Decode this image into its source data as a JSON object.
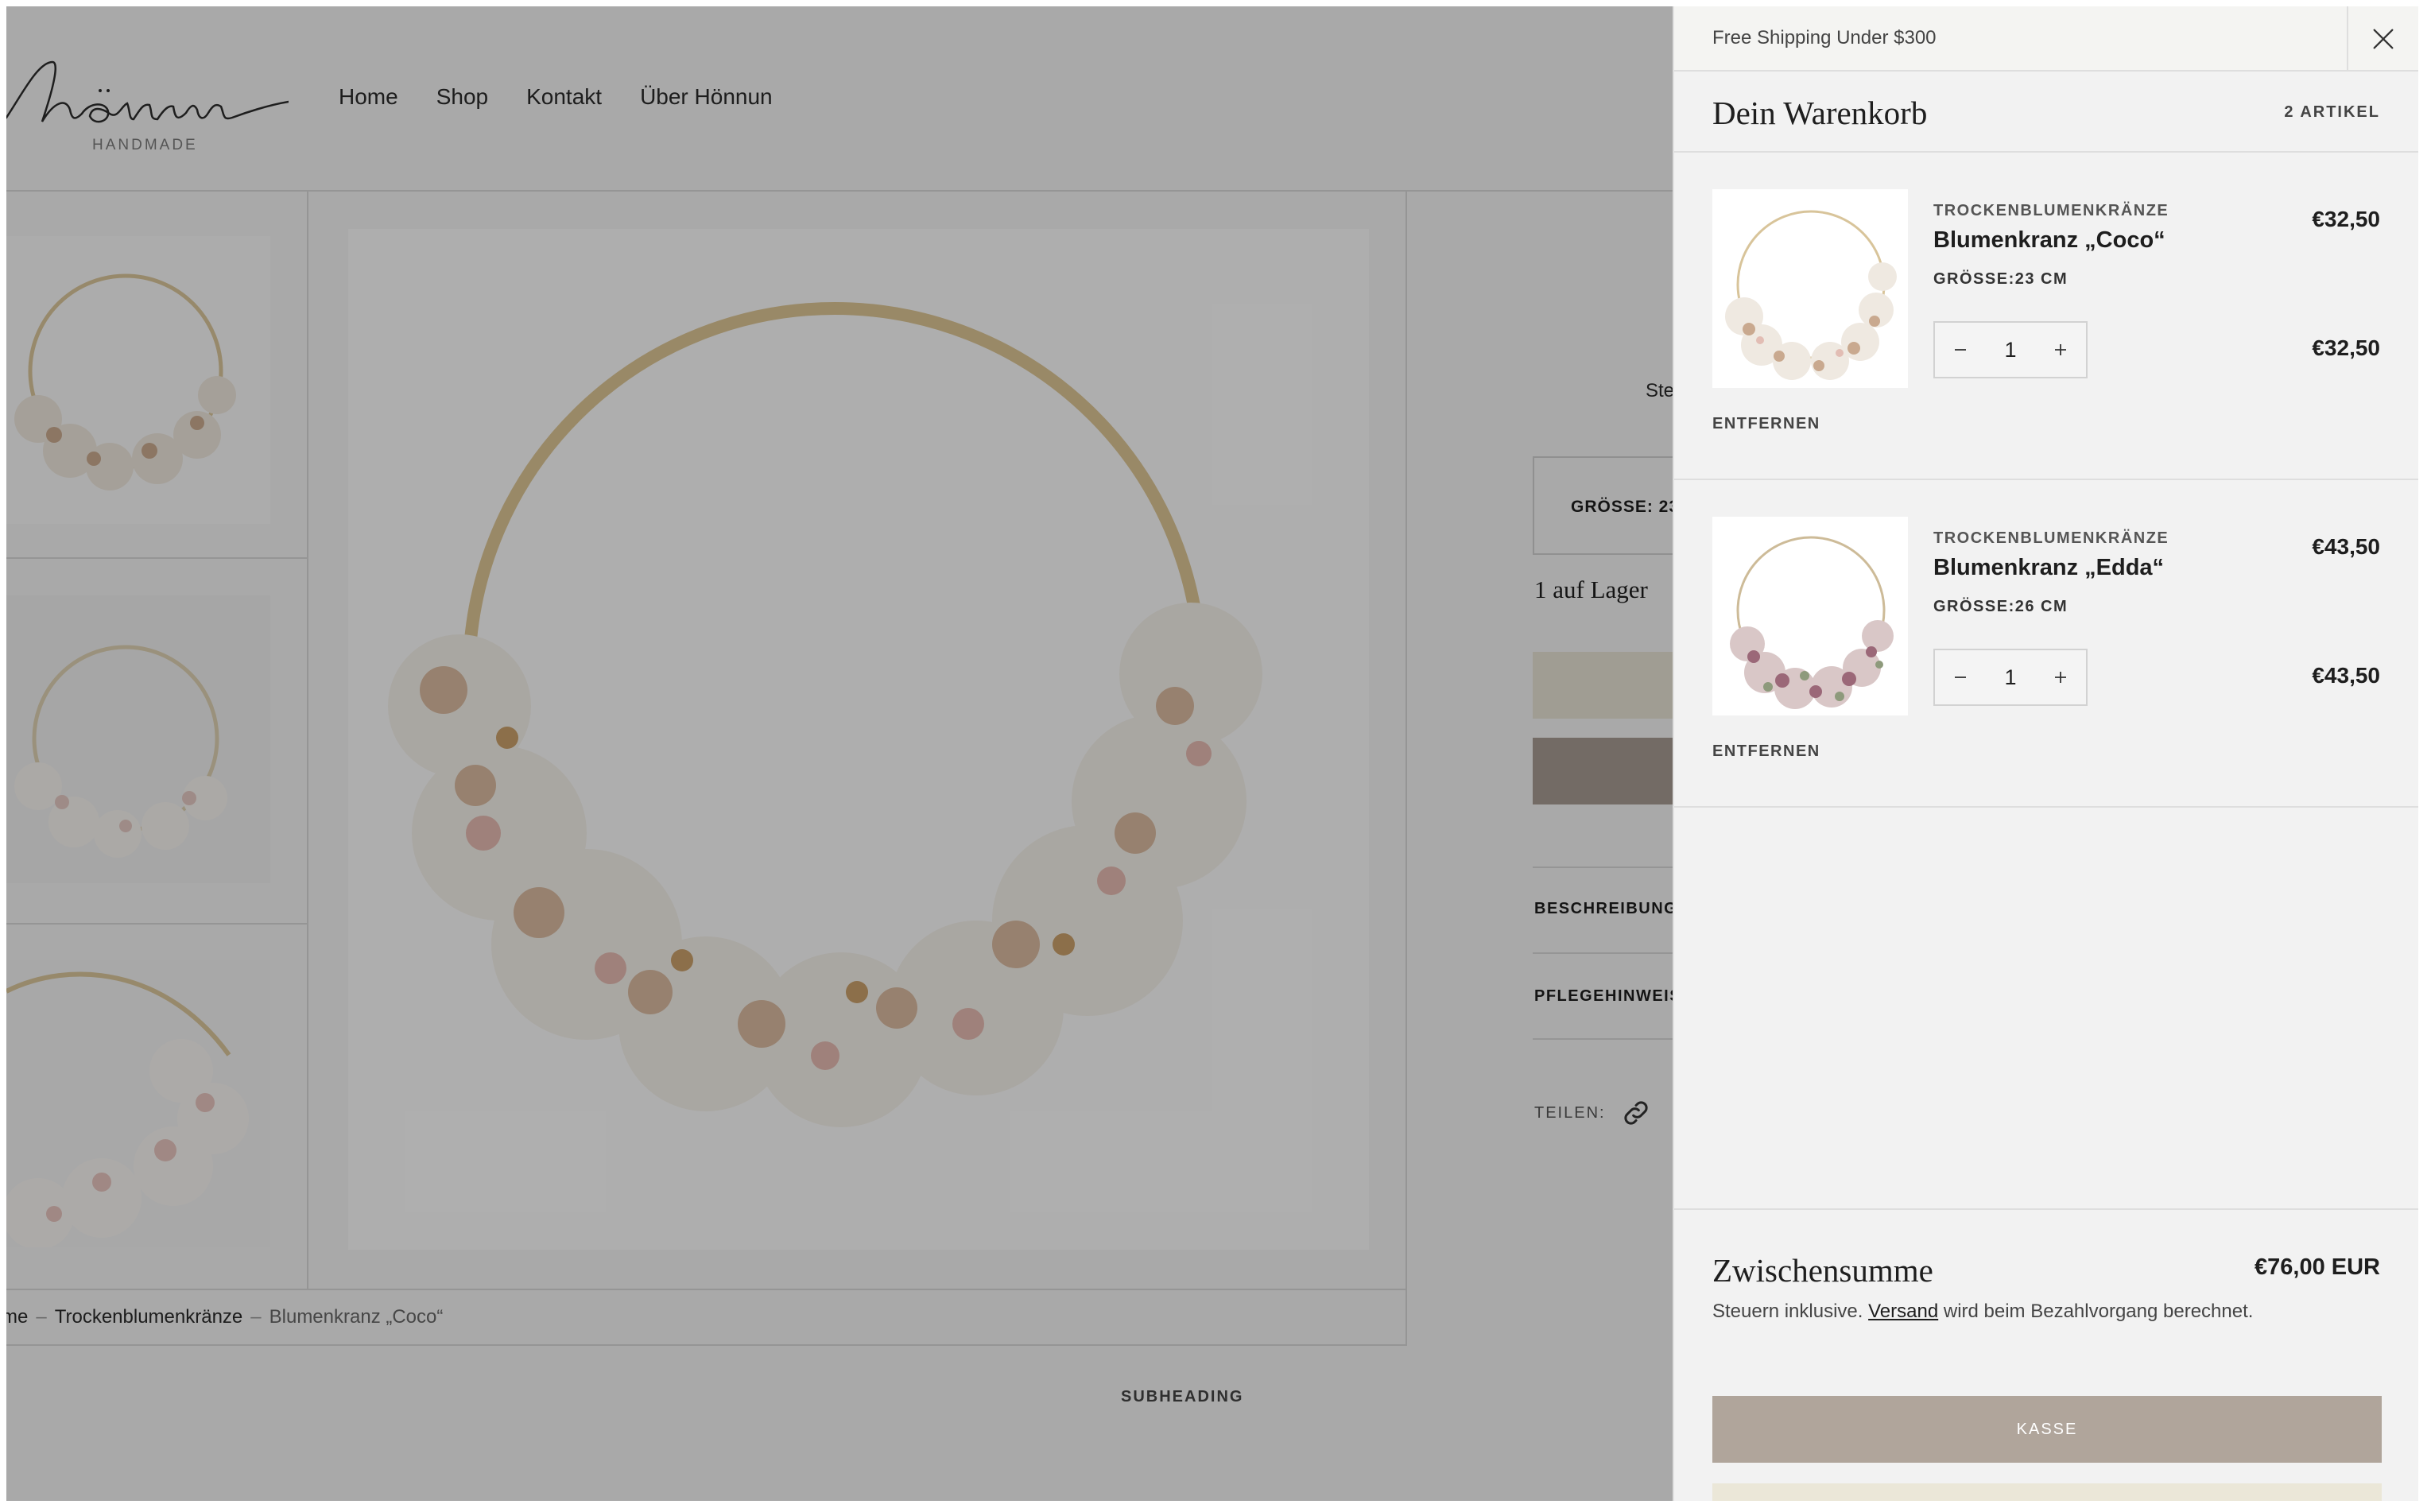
{
  "header": {
    "logo_text": "hönnun",
    "logo_sub": "HANDMADE",
    "nav": [
      "Home",
      "Shop",
      "Kontakt",
      "Über Hönnun"
    ]
  },
  "product": {
    "info_stub": "Ste",
    "size_box_label": "GRÖSSE: 23",
    "stock_text": "1 auf Lager",
    "accordion": [
      "BESCHREIBUNG",
      "PFLEGEHINWEIS"
    ],
    "share_label": "TEILEN:"
  },
  "breadcrumb": {
    "items": [
      "me",
      "Trockenblumenkränze",
      "Blumenkranz „Coco“"
    ]
  },
  "subheading": "SUBHEADING",
  "cart": {
    "announcement": "Free Shipping Under $300",
    "title": "Dein Warenkorb",
    "count_label": "2 ARTIKEL",
    "items": [
      {
        "vendor": "TROCKENBLUMENKRÄNZE",
        "name": "Blumenkranz „Coco“",
        "variant": "GRÖSSE:23 CM",
        "unit_price": "€32,50",
        "quantity": "1",
        "line_price": "€32,50",
        "remove_label": "ENTFERNEN"
      },
      {
        "vendor": "TROCKENBLUMENKRÄNZE",
        "name": "Blumenkranz „Edda“",
        "variant": "GRÖSSE:26 CM",
        "unit_price": "€43,50",
        "quantity": "1",
        "line_price": "€43,50",
        "remove_label": "ENTFERNEN"
      }
    ],
    "subtotal_label": "Zwischensumme",
    "subtotal_value": "€76,00 EUR",
    "tax_note_prefix": "Steuern inklusive.",
    "tax_note_link": "Versand",
    "tax_note_suffix": "wird beim Bezahlvorgang berechnet.",
    "checkout_label": "KASSE"
  },
  "icons": {
    "close": "close-icon",
    "minus": "minus-icon",
    "plus": "plus-icon",
    "link": "link-icon"
  },
  "colors": {
    "checkout_button": "#b0a59b",
    "overlay": "#000000",
    "accent_light": "#e6e1d3"
  }
}
